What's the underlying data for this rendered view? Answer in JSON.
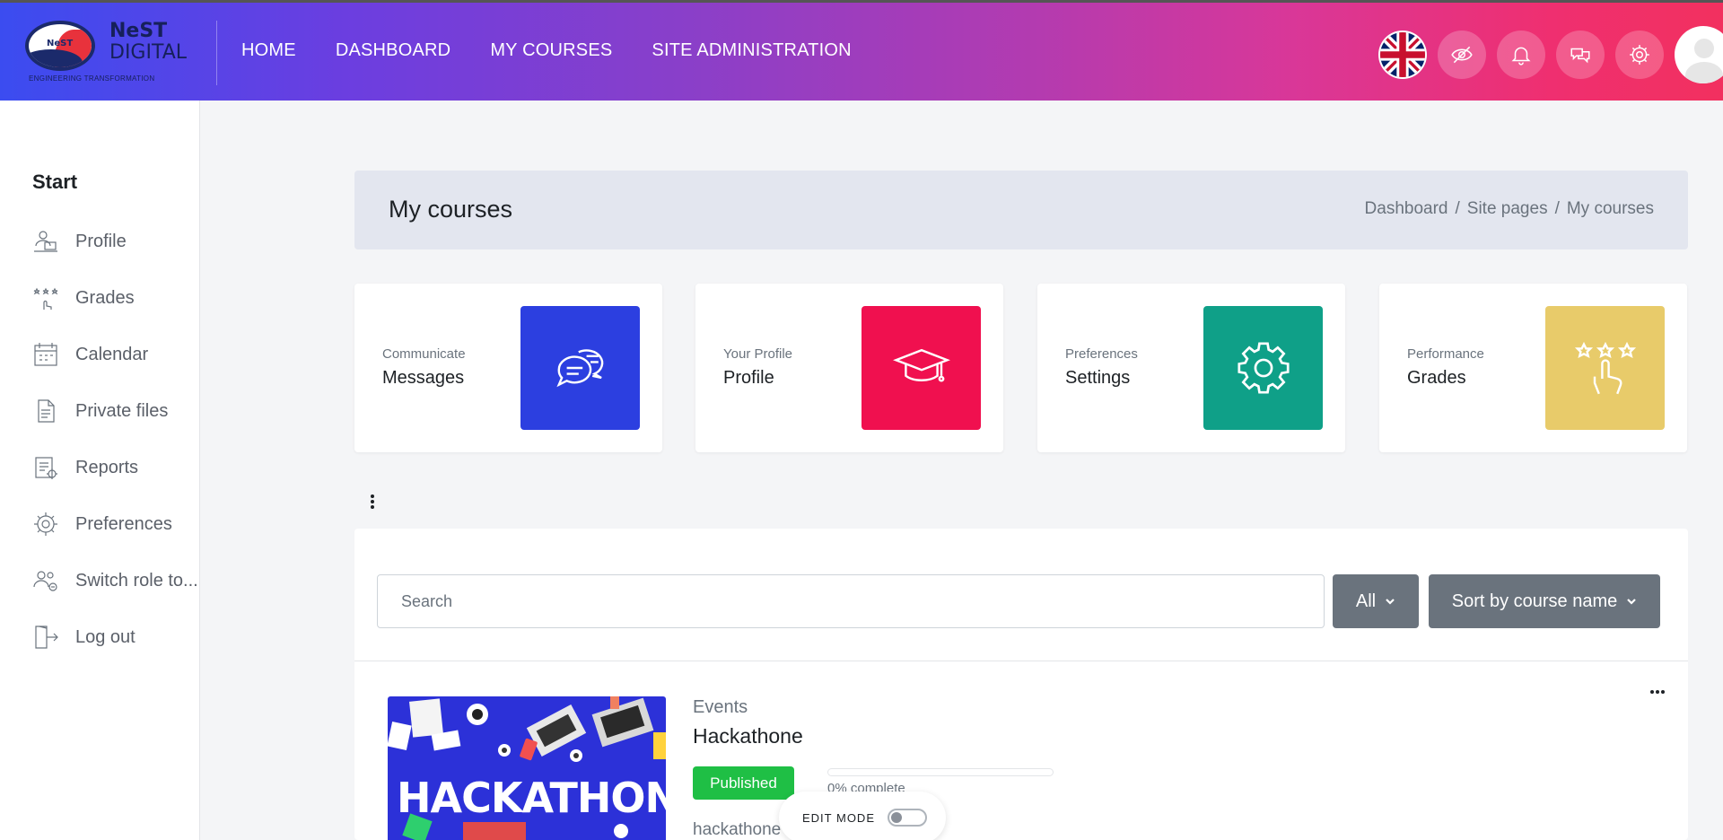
{
  "brand": {
    "name_line1": "NeST",
    "name_line2": "DIGITAL",
    "oval_text": "NeST",
    "tagline": "ENGINEERING TRANSFORMATION"
  },
  "nav": {
    "home": "HOME",
    "dashboard": "DASHBOARD",
    "my_courses": "MY COURSES",
    "site_admin": "SITE ADMINISTRATION"
  },
  "header_icons": [
    "uk-flag-icon",
    "eye-slash-icon",
    "bell-icon",
    "chat-icon",
    "gear-icon",
    "avatar"
  ],
  "sidebar": {
    "title": "Start",
    "items": [
      {
        "label": "Profile",
        "icon": "profile-icon"
      },
      {
        "label": "Grades",
        "icon": "grades-icon"
      },
      {
        "label": "Calendar",
        "icon": "calendar-icon"
      },
      {
        "label": "Private files",
        "icon": "file-icon"
      },
      {
        "label": "Reports",
        "icon": "reports-icon"
      },
      {
        "label": "Preferences",
        "icon": "gear-icon"
      },
      {
        "label": "Switch role to...",
        "icon": "switch-role-icon"
      },
      {
        "label": "Log out",
        "icon": "logout-icon"
      }
    ]
  },
  "page": {
    "title": "My courses",
    "breadcrumb": [
      "Dashboard",
      "Site pages",
      "My courses"
    ],
    "breadcrumb_sep": "/"
  },
  "tiles": [
    {
      "small": "Communicate",
      "big": "Messages",
      "color": "#2c3fe0",
      "icon": "chat-bubbles-icon"
    },
    {
      "small": "Your Profile",
      "big": "Profile",
      "color": "#f0104f",
      "icon": "graduation-cap-icon"
    },
    {
      "small": "Preferences",
      "big": "Settings",
      "color": "#0fa088",
      "icon": "gear-icon"
    },
    {
      "small": "Performance",
      "big": "Grades",
      "color": "#e8cb6a",
      "icon": "grades-icon"
    }
  ],
  "courses_panel": {
    "search_placeholder": "Search",
    "filter_label": "All",
    "sort_label": "Sort by course name"
  },
  "course": {
    "category": "Events",
    "name": "Hackathone",
    "badge": "Published",
    "image_word": "HACKATHON",
    "progress_percent": 0,
    "progress_text": "0% complete",
    "short_name": "hackathone"
  },
  "edit_mode": {
    "label": "EDIT MODE",
    "enabled": false
  }
}
